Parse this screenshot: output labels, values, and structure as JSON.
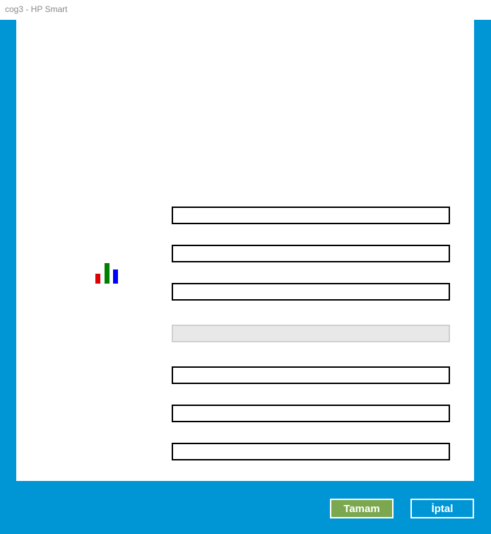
{
  "window": {
    "title": "cog3 - HP Smart"
  },
  "form": {
    "fields": [
      {
        "value": "",
        "readonly": false
      },
      {
        "value": "",
        "readonly": false
      },
      {
        "value": "",
        "readonly": false
      },
      {
        "value": "",
        "readonly": true
      },
      {
        "value": "",
        "readonly": false
      },
      {
        "value": "",
        "readonly": false
      },
      {
        "value": "",
        "readonly": false
      }
    ]
  },
  "icon": {
    "name": "bar-chart-icon",
    "colors": [
      "#e00000",
      "#008000",
      "#0000ff"
    ]
  },
  "buttons": {
    "ok_label": "Tamam",
    "cancel_label": "İptal"
  },
  "colors": {
    "frame": "#0096d6",
    "ok_button": "#7ba84f"
  }
}
